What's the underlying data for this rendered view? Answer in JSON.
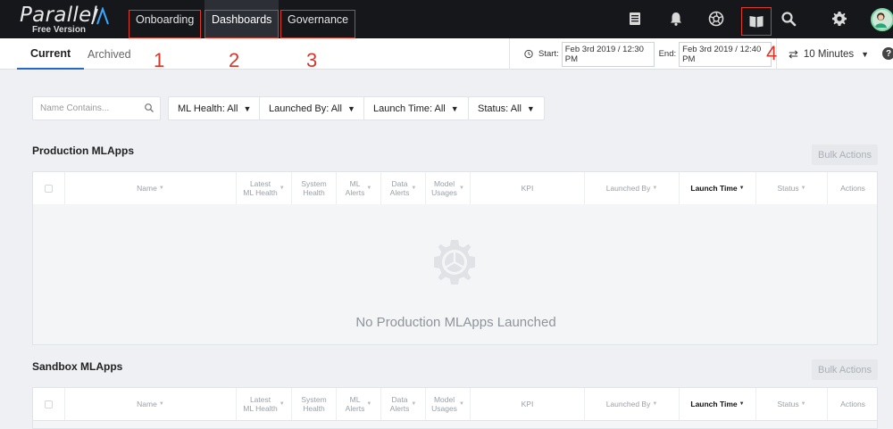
{
  "app": {
    "logo_text": "Parallel",
    "logo_sub": "Free Version"
  },
  "nav": {
    "tabs": [
      {
        "label": "Onboarding",
        "active": false,
        "annotation": "1"
      },
      {
        "label": "Dashboards",
        "active": true,
        "annotation": "2"
      },
      {
        "label": "Governance",
        "active": false,
        "annotation": "3"
      }
    ],
    "icons": [
      "list-icon",
      "bell-icon",
      "aperture-icon",
      "book-icon",
      "search-icon",
      "gear-icon",
      "avatar"
    ],
    "book_annotation": "4"
  },
  "subnav": {
    "tabs": [
      {
        "label": "Current",
        "active": true
      },
      {
        "label": "Archived",
        "active": false
      }
    ],
    "start_label": "Start:",
    "start_value": "Feb 3rd 2019 / 12:30 PM",
    "end_label": "End:",
    "end_value": "Feb 3rd 2019 / 12:40 PM",
    "interval": "10 Minutes",
    "help": "?"
  },
  "filters": {
    "search_placeholder": "Name Contains...",
    "ml_health": "ML Health: All",
    "launched_by": "Launched By: All",
    "launch_time": "Launch Time: All",
    "status": "Status: All"
  },
  "production": {
    "title": "Production MLApps",
    "bulk_actions": "Bulk Actions",
    "empty_message": "No Production MLApps Launched"
  },
  "sandbox": {
    "title": "Sandbox MLApps",
    "bulk_actions": "Bulk Actions"
  },
  "columns": {
    "name": "Name",
    "latest_ml_health_1": "Latest",
    "latest_ml_health_2": "ML Health",
    "system_health_1": "System",
    "system_health_2": "Health",
    "ml_alerts_1": "ML",
    "ml_alerts_2": "Alerts",
    "data_alerts_1": "Data",
    "data_alerts_2": "Alerts",
    "model_usages_1": "Model",
    "model_usages_2": "Usages",
    "kpi": "KPI",
    "launched_by": "Launched By",
    "launch_time": "Launch Time",
    "status": "Status",
    "actions": "Actions"
  },
  "colors": {
    "topbar": "#15171b",
    "annotation_red": "#e0392b",
    "accent_blue": "#2468c9"
  }
}
